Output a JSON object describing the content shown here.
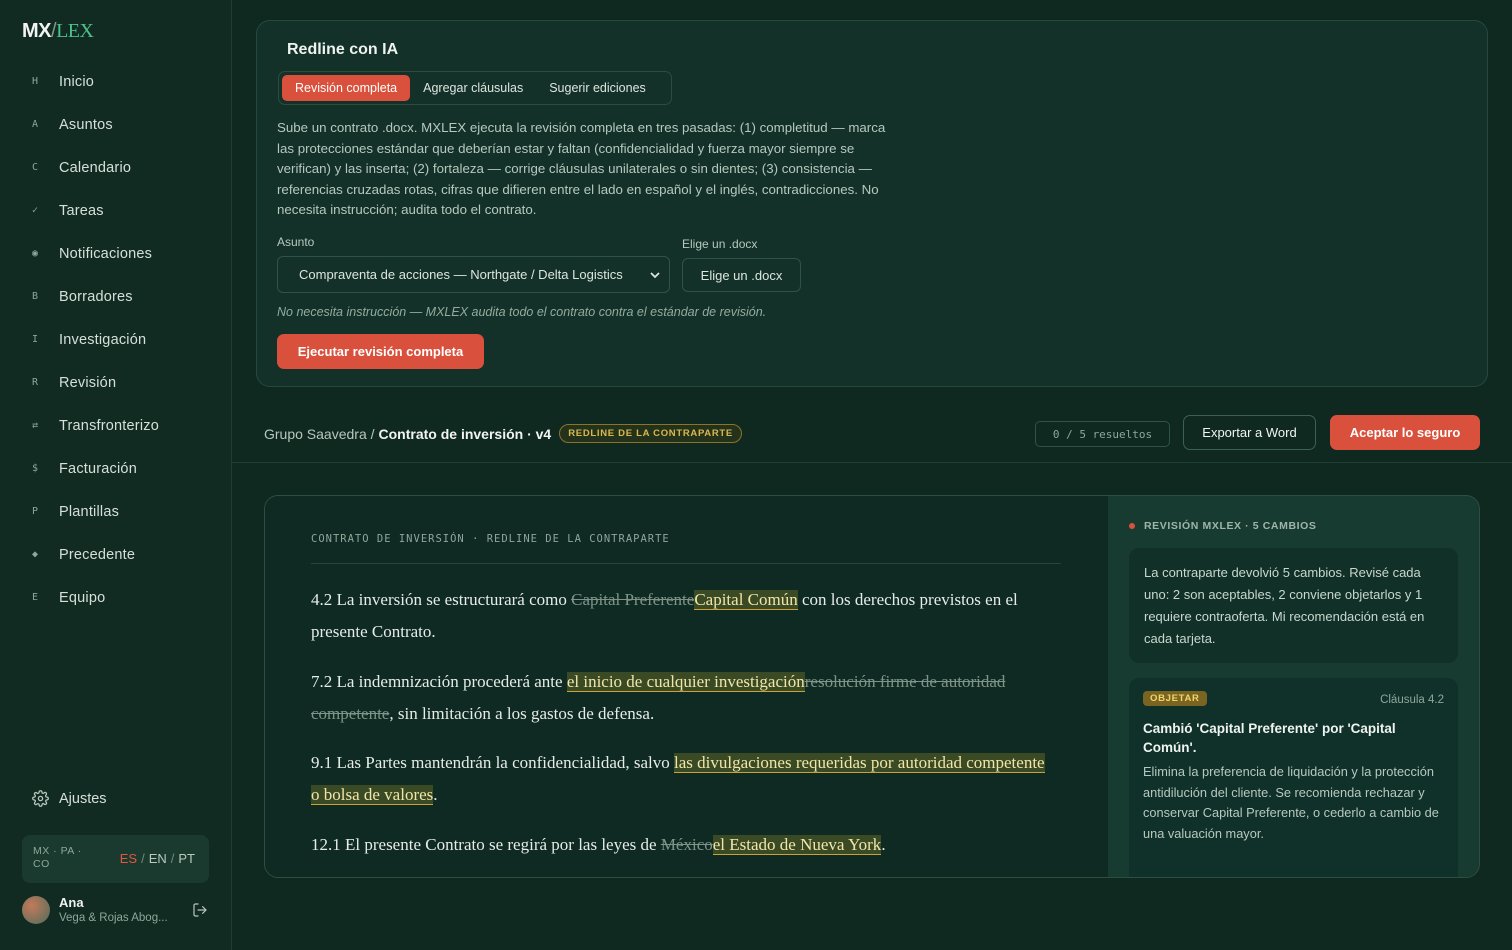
{
  "app": {
    "logo_mx": "MX",
    "logo_slash": "/",
    "logo_lex": "LEX"
  },
  "sidebar": {
    "items": [
      {
        "glyph": "H",
        "label": "Inicio"
      },
      {
        "glyph": "A",
        "label": "Asuntos"
      },
      {
        "glyph": "C",
        "label": "Calendario"
      },
      {
        "glyph": "✓",
        "label": "Tareas"
      },
      {
        "glyph": "◉",
        "label": "Notificaciones"
      },
      {
        "glyph": "B",
        "label": "Borradores"
      },
      {
        "glyph": "I",
        "label": "Investigación"
      },
      {
        "glyph": "R",
        "label": "Revisión"
      },
      {
        "glyph": "⇄",
        "label": "Transfronterizo"
      },
      {
        "glyph": "$",
        "label": "Facturación"
      },
      {
        "glyph": "P",
        "label": "Plantillas"
      },
      {
        "glyph": "◆",
        "label": "Precedente"
      },
      {
        "glyph": "E",
        "label": "Equipo"
      }
    ],
    "settings_label": "Ajustes",
    "region_codes": "MX · PA · CO",
    "languages": {
      "active": "ES",
      "second": "EN",
      "third": "PT",
      "sep": "/"
    },
    "user": {
      "name": "Ana",
      "firm": "Vega & Rojas Abog..."
    }
  },
  "redline": {
    "title": "Redline con IA",
    "tabs": [
      "Revisión completa",
      "Agregar cláusulas",
      "Sugerir ediciones"
    ],
    "active_tab": 0,
    "description": "Sube un contrato .docx. MXLEX ejecuta la revisión completa en tres pasadas: (1) completitud — marca las protecciones estándar que deberían estar y faltan (confidencialidad y fuerza mayor siempre se verifican) y las inserta; (2) fortaleza — corrige cláusulas unilaterales o sin dientes; (3) consistencia — referencias cruzadas rotas, cifras que difieren entre el lado en español y el inglés, contradicciones. No necesita instrucción; audita todo el contrato.",
    "asunto_label": "Asunto",
    "asunto_value": "Compraventa de acciones — Northgate / Delta Logistics",
    "file_label": "Elige un .docx",
    "file_button": "Elige un .docx",
    "note": "No necesita instrucción — MXLEX audita todo el contrato contra el estándar de revisión.",
    "run_button": "Ejecutar revisión completa"
  },
  "breadcrumb": {
    "parent": "Grupo Saavedra /",
    "current": "Contrato de inversión · v4",
    "badge": "REDLINE DE LA CONTRAPARTE"
  },
  "toolbar": {
    "results": "0 / 5 resueltos",
    "export_label": "Exportar a Word",
    "accept_label": "Aceptar lo seguro"
  },
  "document": {
    "header": "CONTRATO DE INVERSIÓN · REDLINE DE LA CONTRAPARTE",
    "clauses": [
      {
        "pre": "4.2 La inversión se estructurará como ",
        "del": "Capital Preferente",
        "ins": "Capital Común",
        "post": " con los derechos previstos en el presente Contrato."
      },
      {
        "pre": "7.2 La indemnización procederá ante ",
        "ins": "el inicio de cualquier investigación",
        "del": "resolución firme de autoridad competente",
        "post": ", sin limitación a los gastos de defensa."
      },
      {
        "pre": "9.1 Las Partes mantendrán la confidencialidad, salvo ",
        "ins": "las divulgaciones requeridas por autoridad competente o bolsa de valores",
        "post": "."
      },
      {
        "pre": "12.1 El presente Contrato se regirá por las leyes de ",
        "del": "México",
        "ins": "el Estado de Nueva York",
        "post": "."
      }
    ]
  },
  "review_panel": {
    "header": "REVISIÓN MXLEX · 5 CAMBIOS",
    "summary": "La contraparte devolvió 5 cambios. Revisé cada uno: 2 son aceptables, 2 conviene objetarlos y 1 requiere contraoferta. Mi recomendación está en cada tarjeta.",
    "card": {
      "tag": "OBJETAR",
      "clause_ref": "Cláusula 4.2",
      "title": "Cambió 'Capital Preferente' por 'Capital Común'.",
      "body": "Elimina la preferencia de liquidación y la protección antidilución del cliente. Se recomienda rechazar y conservar Capital Preferente, o cederlo a cambio de una valuación mayor."
    }
  },
  "colors": {
    "accent": "#d9513c",
    "brand_green": "#4cc28a",
    "insert_gold": "#c9a23a"
  }
}
